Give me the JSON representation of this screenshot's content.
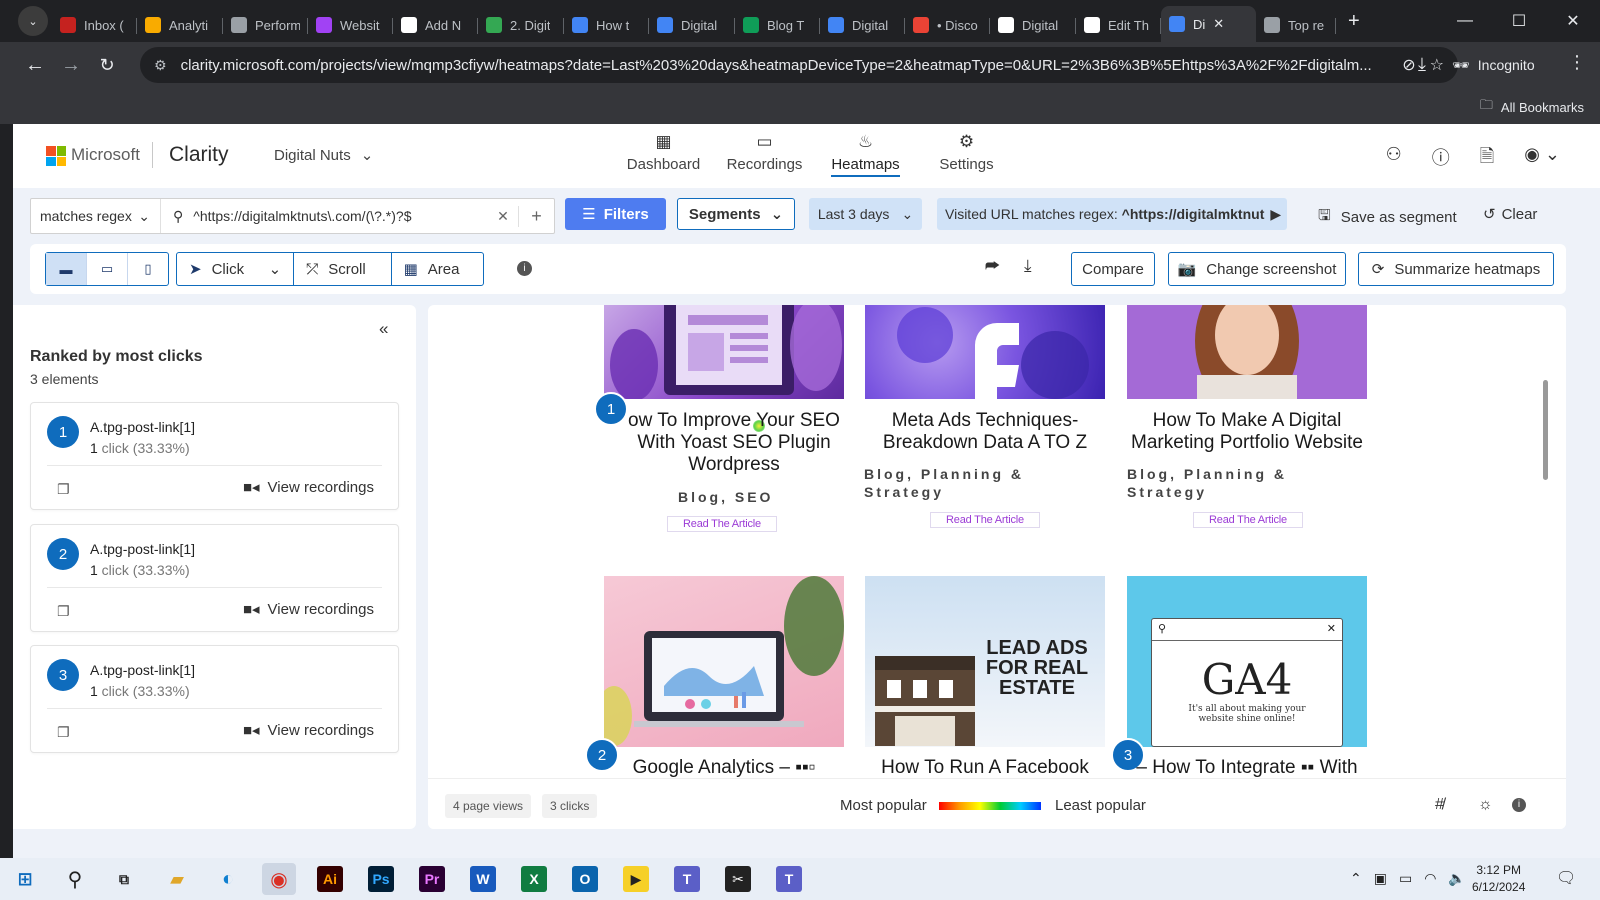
{
  "browser": {
    "tabs": [
      {
        "label": "Inbox (",
        "color": "#c5221f"
      },
      {
        "label": "Analyti",
        "color": "#f9ab00"
      },
      {
        "label": "Perform",
        "color": "#9aa0a6"
      },
      {
        "label": "Websit",
        "color": "#a142f4"
      },
      {
        "label": "Add N",
        "color": "#ffffff"
      },
      {
        "label": "2. Digit",
        "color": "#34a853"
      },
      {
        "label": "How t",
        "color": "#4285f4"
      },
      {
        "label": "Digital",
        "color": "#4285f4"
      },
      {
        "label": "Blog T",
        "color": "#0f9d58"
      },
      {
        "label": "Digital",
        "color": "#4285f4"
      },
      {
        "label": "• Disco",
        "color": "#ea4335"
      },
      {
        "label": "Digital",
        "color": "#ffffff"
      },
      {
        "label": "Edit Th",
        "color": "#ffffff"
      },
      {
        "label": "Di",
        "color": "#4285f4",
        "active": true
      },
      {
        "label": "Top re",
        "color": "#9aa0a6"
      }
    ],
    "url": "clarity.microsoft.com/projects/view/mqmp3cfiyw/heatmaps?date=Last%203%20days&heatmapDeviceType=2&heatmapType=0&URL=2%3B6%3B%5Ehttps%3A%2F%2Fdigitalm...",
    "incognito_label": "Incognito",
    "all_bookmarks_label": "All Bookmarks"
  },
  "header": {
    "brand": "Microsoft",
    "product": "Clarity",
    "project": "Digital Nuts",
    "nav": [
      {
        "label": "Dashboard",
        "icon": "dashboard-icon"
      },
      {
        "label": "Recordings",
        "icon": "video-icon"
      },
      {
        "label": "Heatmaps",
        "icon": "flame-icon",
        "active": true
      },
      {
        "label": "Settings",
        "icon": "gear-icon"
      }
    ]
  },
  "filters": {
    "match_mode": "matches regex",
    "query": "^https://digitalmktnuts\\.com/(\\?.*)?$",
    "filters_label": "Filters",
    "segments_label": "Segments",
    "date_label": "Last 3 days",
    "url_chip_prefix": "Visited URL matches regex: ",
    "url_chip_value": "^https://digitalmktnut",
    "save_segment_label": "Save as segment",
    "clear_label": "Clear"
  },
  "toolbar": {
    "click_label": "Click",
    "scroll_label": "Scroll",
    "area_label": "Area",
    "compare_label": "Compare",
    "change_screenshot_label": "Change screenshot",
    "summarize_label": "Summarize heatmaps"
  },
  "sidebar": {
    "title": "Ranked by most clicks",
    "count": "3 elements",
    "view_recordings_label": "View recordings",
    "items": [
      {
        "rank": "1",
        "selector": "A.tpg-post-link[1]",
        "clicks": "1",
        "click_word": " click (33.33%)"
      },
      {
        "rank": "2",
        "selector": "A.tpg-post-link[1]",
        "clicks": "1",
        "click_word": " click (33.33%)"
      },
      {
        "rank": "3",
        "selector": "A.tpg-post-link[1]",
        "clicks": "1",
        "click_word": " click (33.33%)"
      }
    ]
  },
  "posts": [
    {
      "title": "ow To Improve Your SEO With Yoast SEO Plugin Wordpress",
      "category": "Blog, SEO",
      "read": "Read The Article"
    },
    {
      "title": "Meta Ads Techniques-Breakdown Data A TO Z",
      "category": "Blog, Planning & Strategy",
      "read": "Read The Article"
    },
    {
      "title": "How To Make A Digital Marketing Portfolio Website",
      "category": "Blog, Planning & Strategy",
      "read": "Read The Article"
    },
    {
      "title": "Google Analytics – ▪▪▫",
      "thumb_text": ""
    },
    {
      "title": "How To Run A Facebook",
      "thumb_text": "LEAD ADS FOR REAL ESTATE"
    },
    {
      "title": "– How To Integrate ▪▪ With",
      "thumb_text": "GA4",
      "thumb_sub": "It's all about making your website shine online!"
    }
  ],
  "markers": [
    "1",
    "2",
    "3"
  ],
  "status": {
    "page_views": "4 page views",
    "clicks": "3 clicks",
    "most_popular": "Most popular",
    "least_popular": "Least popular"
  },
  "taskbar": {
    "time": "3:12 PM",
    "date": "6/12/2024"
  },
  "colors": {
    "accent": "#0f6cbd",
    "filters_button": "#4e7cf0",
    "chip": "#d0e2f7",
    "link_purple": "#9b3bd6"
  }
}
